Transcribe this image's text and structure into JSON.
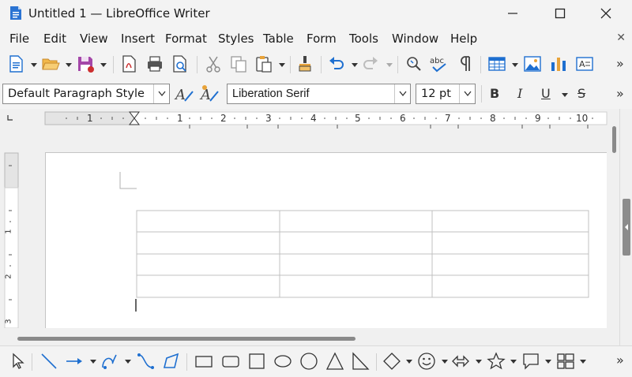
{
  "window": {
    "title": "Untitled 1 — LibreOffice Writer"
  },
  "menubar": {
    "items": [
      "File",
      "Edit",
      "View",
      "Insert",
      "Format",
      "Styles",
      "Table",
      "Form",
      "Tools",
      "Window",
      "Help"
    ],
    "close_label": "✕"
  },
  "formatting": {
    "paragraph_style": "Default Paragraph Style",
    "font_name": "Liberation Serif",
    "font_size": "12 pt",
    "bold_label": "B",
    "italic_label": "I",
    "underline_label": "U",
    "strikethrough_label": "S"
  },
  "ruler": {
    "unit_labels": [
      "1",
      "1",
      "2",
      "3",
      "4",
      "5",
      "6",
      "7",
      "8",
      "9",
      "10"
    ],
    "vertical_labels": [
      "1",
      "2",
      "3"
    ]
  },
  "table": {
    "rows": 4,
    "columns": 3
  },
  "overflow_glyph": "»",
  "icons": {
    "app": "writer-document-icon",
    "accent_blue": "#1e6fd0",
    "accent_red": "#cc2f2f",
    "accent_orange": "#e8a33a"
  }
}
